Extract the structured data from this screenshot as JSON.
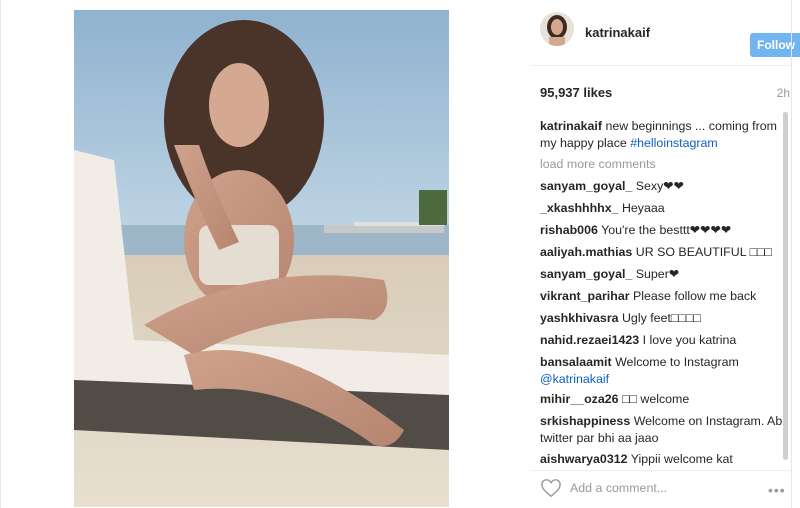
{
  "post": {
    "username": "katrinakaif",
    "follow_label": "Follow",
    "likes": "95,937 likes",
    "time": "2h",
    "caption_user": "katrinakaif",
    "caption_text": "new beginnings ... coming from my happy place",
    "caption_hashtag": "#helloinstagram",
    "load_more": "load more comments",
    "add_comment_placeholder": "Add a comment...",
    "more_icon": "more-options-icon"
  },
  "comments": [
    {
      "user": "sanyam_goyal_",
      "text": "Sexy❤❤"
    },
    {
      "user": "_xkashhhhx_",
      "text": "Heyaaa"
    },
    {
      "user": "rishab006",
      "text": "You're the besttt❤❤❤❤"
    },
    {
      "user": "aaliyah.mathias",
      "text": "UR SO BEAUTIFUL □□□"
    },
    {
      "user": "sanyam_goyal_",
      "text": "Super❤"
    },
    {
      "user": "vikrant_parihar",
      "text": "Please follow me back"
    },
    {
      "user": "yashkhivasra",
      "text": "Ugly feet□□□□"
    },
    {
      "user": "nahid.rezaei1423",
      "text": "I love you katrina"
    },
    {
      "user": "bansalaamit",
      "text": "Welcome to Instagram",
      "mention": "@katrinakaif"
    },
    {
      "user": "mihir__oza26",
      "text": "□□ welcome"
    },
    {
      "user": "srkishappiness",
      "text": "Welcome on Instagram. Ab twitter par bhi aa jaao"
    },
    {
      "user": "aishwarya0312",
      "text": "Yippii welcome kat"
    }
  ],
  "colors": {
    "accent": "#70b4f0",
    "hashtag": "#0f5ec3",
    "muted": "#999999"
  }
}
